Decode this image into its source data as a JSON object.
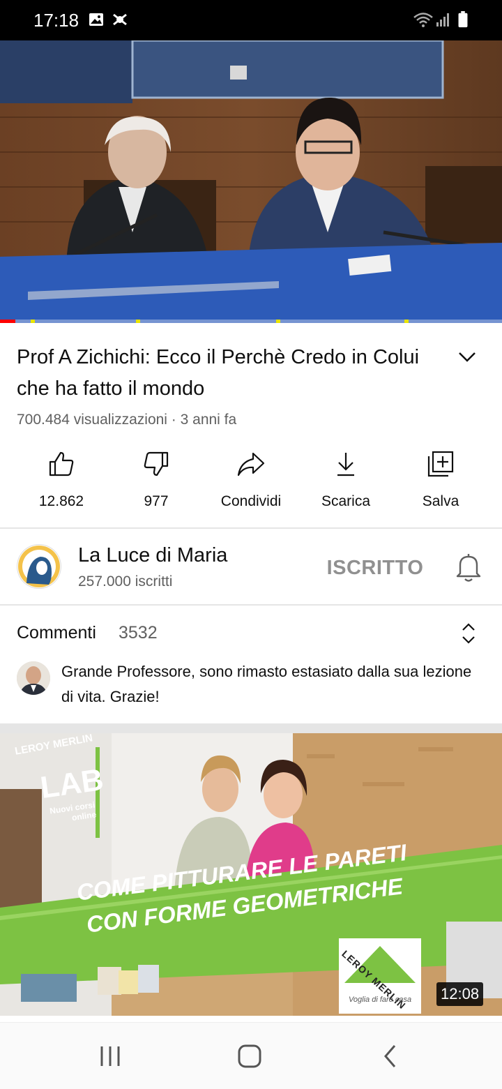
{
  "status_bar": {
    "time": "17:18"
  },
  "video": {
    "progress_fraction": 0.03,
    "title": "Prof  A  Zichichi: Ecco il Perchè Credo in Colui che ha fatto il mondo",
    "meta": "700.484 visualizzazioni · 3 anni fa"
  },
  "actions": {
    "like": "12.862",
    "dislike": "977",
    "share": "Condividi",
    "download": "Scarica",
    "save": "Salva"
  },
  "channel": {
    "name": "La Luce di Maria",
    "subscribers": "257.000 iscritti",
    "subscribe_label": "ISCRITTO"
  },
  "comments": {
    "title": "Commenti",
    "count": "3532",
    "top_comment": "Grande Professore, sono rimasto estasiato dalla sua lezione di vita. Grazie!"
  },
  "next_video": {
    "duration": "12:08",
    "brand_small": "LEROY MERLIN",
    "lab": "LAB",
    "lab_sub1": "Nuovi corsi",
    "lab_sub2": "online",
    "banner_line1": "COME PITTURARE LE PARETI",
    "banner_line2": "CON FORME GEOMETRICHE",
    "logo_text": "LEROY MERLIN",
    "slogan": "Voglia di fare casa"
  },
  "colors": {
    "progress": "#ff0000",
    "ad_marker": "#e8e400",
    "secondary_text": "#606060"
  }
}
